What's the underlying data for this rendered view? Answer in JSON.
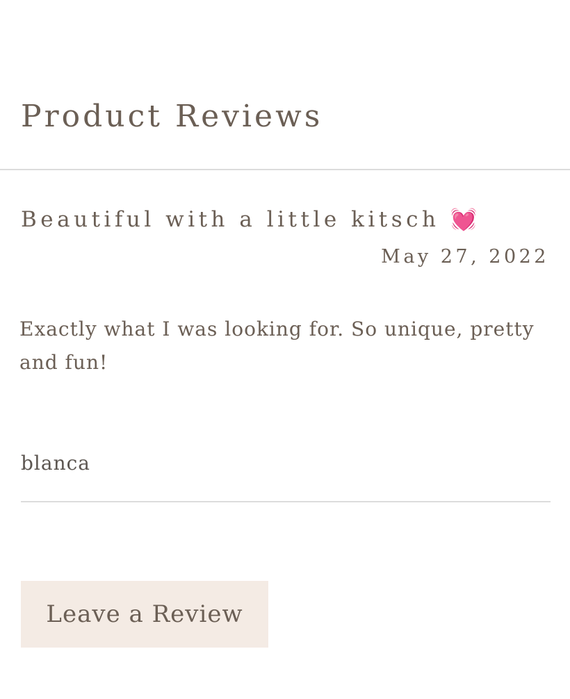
{
  "section": {
    "title": "Product Reviews"
  },
  "reviews": [
    {
      "title": "Beautiful with a little kitsch",
      "title_emoji": "💓",
      "date": "May 27, 2022",
      "body": "Exactly what I was looking for. So unique, pretty and fun!",
      "author": "blanca"
    }
  ],
  "actions": {
    "leave_review_label": "Leave a Review"
  },
  "colors": {
    "text": "#6b5f55",
    "divider": "#dcdcdc",
    "button_background": "#f4ebe4"
  }
}
